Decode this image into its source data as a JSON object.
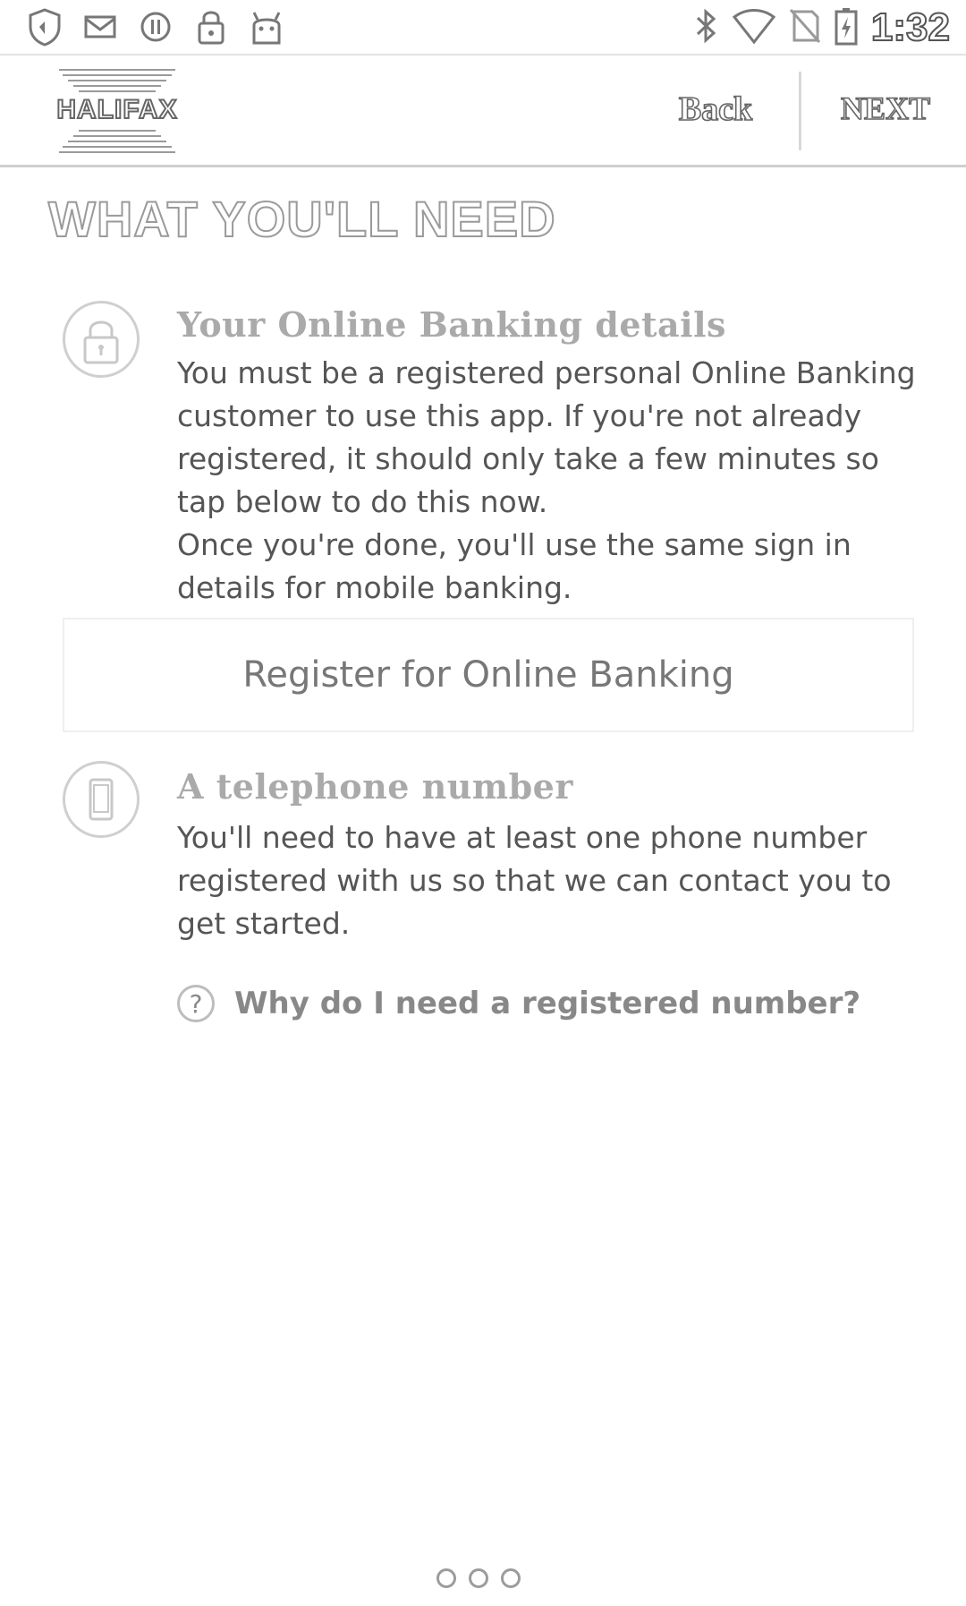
{
  "status_bar": {
    "left_icons": [
      "shield-icon",
      "mail-icon",
      "circle-icon",
      "lock-icon",
      "android-icon"
    ],
    "right_icons": [
      "bluetooth-icon",
      "wifi-icon",
      "no-sim-icon",
      "battery-icon"
    ],
    "time": "1:32"
  },
  "header": {
    "logo_text": "HALIFAX",
    "back_label": "Back",
    "next_label": "NEXT"
  },
  "page": {
    "title": "WHAT YOU'LL NEED"
  },
  "sections": [
    {
      "icon": "padlock-icon",
      "title": "Your Online Banking details",
      "body_lines": [
        "You must be a registered personal Online Banking",
        "customer to use this app. If you're not already",
        "registered, it should only take a few minutes so",
        "tap below to do this now.",
        "Once you're done, you'll use the same sign in",
        "details for mobile banking."
      ],
      "button_label": "Register for Online Banking"
    },
    {
      "icon": "phone-icon",
      "title": "A telephone number",
      "body_lines": [
        "You'll need to have at least one phone number",
        "registered with us so that we can contact you to",
        "get started."
      ],
      "help_link": "Why do I need a registered number?"
    }
  ],
  "pager": {
    "count": 3,
    "active": 0
  },
  "colors": {
    "text": "#555555",
    "muted": "#aaaaaa",
    "divider": "#cfcfcf"
  }
}
